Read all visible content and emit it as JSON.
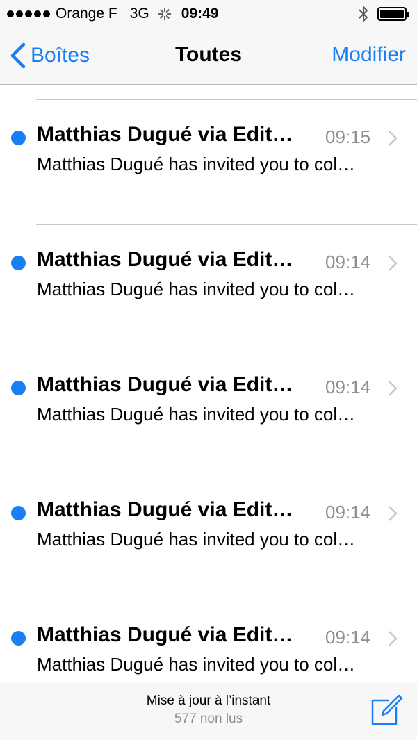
{
  "status_bar": {
    "carrier": "Orange F",
    "network": "3G",
    "time": "09:49"
  },
  "nav": {
    "back_label": "Boîtes",
    "title": "Toutes",
    "edit_label": "Modifier"
  },
  "messages": [
    {
      "sender": "Matthias Dugué via Edit…",
      "time": "09:15",
      "preview": "Matthias Dugué has invited you to col…",
      "unread": true
    },
    {
      "sender": "Matthias Dugué via Edit…",
      "time": "09:14",
      "preview": "Matthias Dugué has invited you to col…",
      "unread": true
    },
    {
      "sender": "Matthias Dugué via Edit…",
      "time": "09:14",
      "preview": "Matthias Dugué has invited you to col…",
      "unread": true
    },
    {
      "sender": "Matthias Dugué via Edit…",
      "time": "09:14",
      "preview": "Matthias Dugué has invited you to col…",
      "unread": true
    },
    {
      "sender": "Matthias Dugué via Edit…",
      "time": "09:14",
      "preview": "Matthias Dugué has invited you to col…",
      "unread": true
    }
  ],
  "toolbar": {
    "update_status": "Mise à jour à l’instant",
    "unread_count": "577 non lus"
  },
  "icons": {
    "signal": "signal-dots-icon",
    "activity": "activity-spinner-icon",
    "bluetooth": "bluetooth-icon",
    "battery": "battery-icon",
    "back": "chevron-left-icon",
    "disclosure": "chevron-right-icon",
    "compose": "compose-icon"
  },
  "colors": {
    "accent": "#1a7ff5",
    "secondary_text": "#8e8e93"
  }
}
